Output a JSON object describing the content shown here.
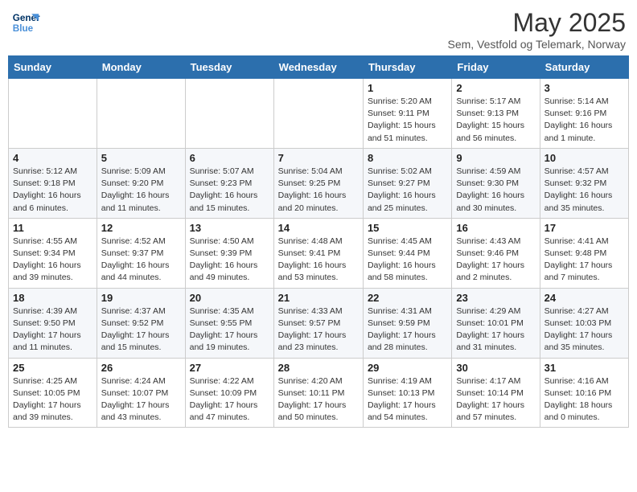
{
  "logo": {
    "line1": "General",
    "line2": "Blue"
  },
  "title": "May 2025",
  "subtitle": "Sem, Vestfold og Telemark, Norway",
  "weekdays": [
    "Sunday",
    "Monday",
    "Tuesday",
    "Wednesday",
    "Thursday",
    "Friday",
    "Saturday"
  ],
  "weeks": [
    [
      {
        "day": "",
        "info": ""
      },
      {
        "day": "",
        "info": ""
      },
      {
        "day": "",
        "info": ""
      },
      {
        "day": "",
        "info": ""
      },
      {
        "day": "1",
        "info": "Sunrise: 5:20 AM\nSunset: 9:11 PM\nDaylight: 15 hours\nand 51 minutes."
      },
      {
        "day": "2",
        "info": "Sunrise: 5:17 AM\nSunset: 9:13 PM\nDaylight: 15 hours\nand 56 minutes."
      },
      {
        "day": "3",
        "info": "Sunrise: 5:14 AM\nSunset: 9:16 PM\nDaylight: 16 hours\nand 1 minute."
      }
    ],
    [
      {
        "day": "4",
        "info": "Sunrise: 5:12 AM\nSunset: 9:18 PM\nDaylight: 16 hours\nand 6 minutes."
      },
      {
        "day": "5",
        "info": "Sunrise: 5:09 AM\nSunset: 9:20 PM\nDaylight: 16 hours\nand 11 minutes."
      },
      {
        "day": "6",
        "info": "Sunrise: 5:07 AM\nSunset: 9:23 PM\nDaylight: 16 hours\nand 15 minutes."
      },
      {
        "day": "7",
        "info": "Sunrise: 5:04 AM\nSunset: 9:25 PM\nDaylight: 16 hours\nand 20 minutes."
      },
      {
        "day": "8",
        "info": "Sunrise: 5:02 AM\nSunset: 9:27 PM\nDaylight: 16 hours\nand 25 minutes."
      },
      {
        "day": "9",
        "info": "Sunrise: 4:59 AM\nSunset: 9:30 PM\nDaylight: 16 hours\nand 30 minutes."
      },
      {
        "day": "10",
        "info": "Sunrise: 4:57 AM\nSunset: 9:32 PM\nDaylight: 16 hours\nand 35 minutes."
      }
    ],
    [
      {
        "day": "11",
        "info": "Sunrise: 4:55 AM\nSunset: 9:34 PM\nDaylight: 16 hours\nand 39 minutes."
      },
      {
        "day": "12",
        "info": "Sunrise: 4:52 AM\nSunset: 9:37 PM\nDaylight: 16 hours\nand 44 minutes."
      },
      {
        "day": "13",
        "info": "Sunrise: 4:50 AM\nSunset: 9:39 PM\nDaylight: 16 hours\nand 49 minutes."
      },
      {
        "day": "14",
        "info": "Sunrise: 4:48 AM\nSunset: 9:41 PM\nDaylight: 16 hours\nand 53 minutes."
      },
      {
        "day": "15",
        "info": "Sunrise: 4:45 AM\nSunset: 9:44 PM\nDaylight: 16 hours\nand 58 minutes."
      },
      {
        "day": "16",
        "info": "Sunrise: 4:43 AM\nSunset: 9:46 PM\nDaylight: 17 hours\nand 2 minutes."
      },
      {
        "day": "17",
        "info": "Sunrise: 4:41 AM\nSunset: 9:48 PM\nDaylight: 17 hours\nand 7 minutes."
      }
    ],
    [
      {
        "day": "18",
        "info": "Sunrise: 4:39 AM\nSunset: 9:50 PM\nDaylight: 17 hours\nand 11 minutes."
      },
      {
        "day": "19",
        "info": "Sunrise: 4:37 AM\nSunset: 9:52 PM\nDaylight: 17 hours\nand 15 minutes."
      },
      {
        "day": "20",
        "info": "Sunrise: 4:35 AM\nSunset: 9:55 PM\nDaylight: 17 hours\nand 19 minutes."
      },
      {
        "day": "21",
        "info": "Sunrise: 4:33 AM\nSunset: 9:57 PM\nDaylight: 17 hours\nand 23 minutes."
      },
      {
        "day": "22",
        "info": "Sunrise: 4:31 AM\nSunset: 9:59 PM\nDaylight: 17 hours\nand 28 minutes."
      },
      {
        "day": "23",
        "info": "Sunrise: 4:29 AM\nSunset: 10:01 PM\nDaylight: 17 hours\nand 31 minutes."
      },
      {
        "day": "24",
        "info": "Sunrise: 4:27 AM\nSunset: 10:03 PM\nDaylight: 17 hours\nand 35 minutes."
      }
    ],
    [
      {
        "day": "25",
        "info": "Sunrise: 4:25 AM\nSunset: 10:05 PM\nDaylight: 17 hours\nand 39 minutes."
      },
      {
        "day": "26",
        "info": "Sunrise: 4:24 AM\nSunset: 10:07 PM\nDaylight: 17 hours\nand 43 minutes."
      },
      {
        "day": "27",
        "info": "Sunrise: 4:22 AM\nSunset: 10:09 PM\nDaylight: 17 hours\nand 47 minutes."
      },
      {
        "day": "28",
        "info": "Sunrise: 4:20 AM\nSunset: 10:11 PM\nDaylight: 17 hours\nand 50 minutes."
      },
      {
        "day": "29",
        "info": "Sunrise: 4:19 AM\nSunset: 10:13 PM\nDaylight: 17 hours\nand 54 minutes."
      },
      {
        "day": "30",
        "info": "Sunrise: 4:17 AM\nSunset: 10:14 PM\nDaylight: 17 hours\nand 57 minutes."
      },
      {
        "day": "31",
        "info": "Sunrise: 4:16 AM\nSunset: 10:16 PM\nDaylight: 18 hours\nand 0 minutes."
      }
    ]
  ]
}
